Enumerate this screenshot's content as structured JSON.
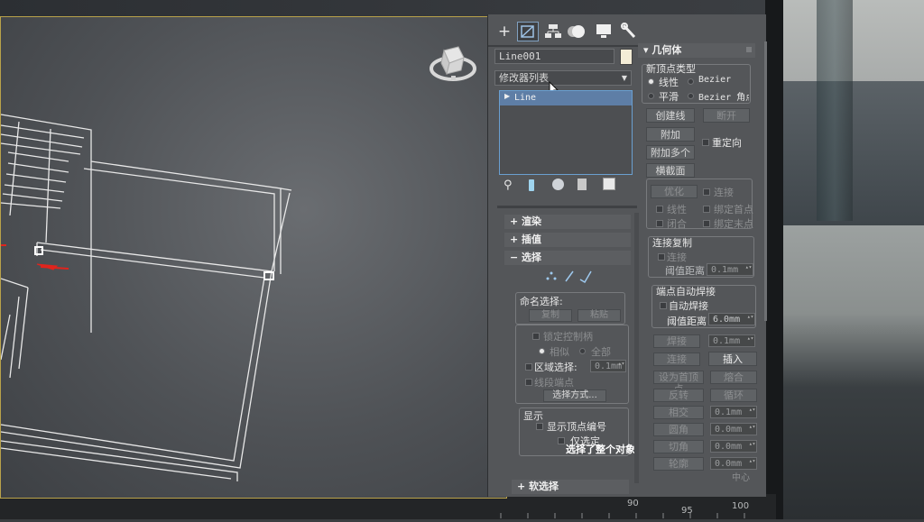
{
  "command_panel": {
    "tabs": [
      {
        "icon": "plus-icon"
      },
      {
        "icon": "modify-icon"
      },
      {
        "icon": "hierarchy-icon"
      },
      {
        "icon": "motion-icon"
      },
      {
        "icon": "display-icon"
      },
      {
        "icon": "wrench-icon"
      }
    ],
    "object_name": "Line001",
    "modifier_list_label": "修改器列表",
    "stack_item": "Line",
    "rollouts": {
      "render": "渲染",
      "interpolation": "插值",
      "selection": "选择",
      "soft_selection": "软选择",
      "geometry": "几何体"
    },
    "selection": {
      "named_selection_label": "命名选择:",
      "copy": "复制",
      "paste": "粘贴",
      "lock_handles": "锁定控制柄",
      "similar": "相似",
      "all": "全部",
      "area_select": "区域选择:",
      "area_value": "0.1mm",
      "segment_end": "线段端点",
      "select_by": "选择方式...",
      "display_label": "显示",
      "show_vertex_numbers": "显示顶点编号",
      "selected_only": "仅选定",
      "status": "选择了整个对象"
    },
    "geometry": {
      "new_vertex_type": "新顶点类型",
      "linear": "线性",
      "bezier": "Bezier",
      "smooth": "平滑",
      "bezier_corner": "Bezier 角点",
      "create_line": "创建线",
      "break": "断开",
      "attach": "附加",
      "attach_multiple": "附加多个",
      "reorient": "重定向",
      "cross_section": "横截面",
      "optimize": "优化",
      "connect": "连接",
      "linear2": "线性",
      "bind_first": "绑定首点",
      "closed": "闭合",
      "bind_last": "绑定末点",
      "connect_copy": "连接复制",
      "connect2": "连接",
      "threshold_distance": "阈值距离",
      "threshold_value": "0.1mm",
      "end_auto_weld": "端点自动焊接",
      "auto_weld": "自动焊接",
      "threshold_distance2": "阈值距离",
      "weld_threshold_value": "6.0mm",
      "weld": "焊接",
      "weld_value": "0.1mm",
      "connect3": "连接",
      "insert": "插入",
      "make_first": "设为首顶点",
      "fuse": "熔合",
      "reverse": "反转",
      "cycle": "循环",
      "intersect": "相交",
      "intersect_value": "0.1mm",
      "fillet": "圆角",
      "fillet_value": "0.0mm",
      "chamfer": "切角",
      "chamfer_value": "0.0mm",
      "outline": "轮廓",
      "outline_value": "0.0mm",
      "center": "中心"
    }
  },
  "timeline": {
    "ticks": [
      "90",
      "95",
      "100"
    ]
  }
}
